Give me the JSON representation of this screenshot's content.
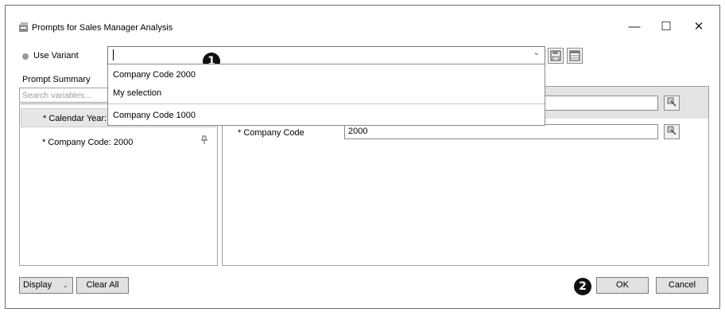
{
  "window": {
    "title": "Prompts for Sales Manager Analysis",
    "minimize_glyph": "—",
    "maximize_glyph": "☐",
    "close_glyph": "✕"
  },
  "variant": {
    "label": "Use Variant",
    "value": "",
    "options": [
      "Company Code 2000",
      "My selection",
      "Company Code 1000"
    ]
  },
  "summary": {
    "label": "Prompt Summary",
    "search_placeholder": "Search variables...",
    "items": [
      "* Calendar Year: 2",
      "* Company Code: 2000"
    ]
  },
  "fields": [
    {
      "label": "",
      "value": ""
    },
    {
      "label": "* Company Code",
      "value": "2000"
    }
  ],
  "footer": {
    "display_label": "Display",
    "clear_all": "Clear All",
    "ok": "OK",
    "cancel": "Cancel"
  },
  "callouts": [
    "1",
    "2"
  ],
  "icons": {
    "app": "window-app-icon",
    "save": "save-icon",
    "table": "table-icon",
    "pin": "pin-icon",
    "picker": "value-picker-icon"
  }
}
